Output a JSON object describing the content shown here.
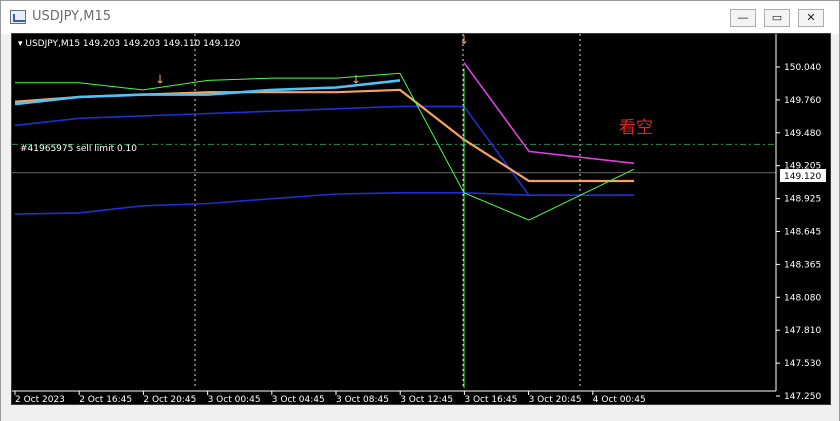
{
  "window": {
    "title": "USDJPY,M15",
    "buttons": {
      "minimize": "—",
      "maximize": "▭",
      "close": "✕"
    }
  },
  "chart": {
    "symbol_header": "▾ USDJPY,M15  149.203 149.203 149.110 149.120",
    "order_label": "#41965975 sell limit 0.10",
    "annotation": "看空",
    "current_price": "149.120",
    "price_axis": [
      "150.040",
      "149.760",
      "149.480",
      "149.205",
      "148.925",
      "148.645",
      "148.365",
      "148.080",
      "147.810",
      "147.530",
      "147.250"
    ],
    "time_axis": [
      "2 Oct 2023",
      "2 Oct 16:45",
      "2 Oct 20:45",
      "3 Oct 00:45",
      "3 Oct 04:45",
      "3 Oct 08:45",
      "3 Oct 12:45",
      "3 Oct 16:45",
      "3 Oct 20:45",
      "4 Oct 00:45"
    ]
  },
  "chart_data": {
    "type": "line",
    "title": "USDJPY,M15",
    "ohlc_last": {
      "open": 149.203,
      "high": 149.203,
      "low": 149.11,
      "close": 149.12
    },
    "order": {
      "id": "#41965975",
      "type": "sell limit",
      "volume": 0.1,
      "price": 149.36
    },
    "ylim": [
      147.25,
      150.25
    ],
    "x": [
      "2 Oct 2023",
      "2 Oct 16:45",
      "2 Oct 20:45",
      "3 Oct 00:45",
      "3 Oct 04:45",
      "3 Oct 08:45",
      "3 Oct 12:45",
      "3 Oct 16:45",
      "3 Oct 20:45",
      "4 Oct 00:45"
    ],
    "series": [
      {
        "values": [
          149.88,
          149.88,
          149.82,
          149.9,
          149.92,
          149.92,
          149.96,
          148.95,
          148.72,
          149.15
        ]
      },
      {
        "color": "#4fc3f7",
        "values": [
          149.7,
          149.76,
          149.78,
          149.78,
          149.82,
          149.84,
          149.9,
          null,
          null,
          null
        ]
      },
      {
        "color": "#f4a460",
        "values": [
          149.72,
          149.76,
          149.78,
          149.8,
          149.8,
          149.8,
          149.82,
          149.4,
          149.05,
          149.05
        ]
      },
      {
        "color": "#e040e0",
        "values": [
          null,
          null,
          null,
          null,
          null,
          null,
          null,
          150.05,
          149.3,
          149.2
        ]
      },
      {
        "color": "#1f2fd0",
        "values": [
          149.52,
          149.58,
          149.6,
          149.62,
          149.64,
          149.66,
          149.68,
          149.68,
          148.93,
          148.93
        ]
      },
      {
        "color": "#1f2fd0",
        "values": [
          148.77,
          148.78,
          148.84,
          148.86,
          148.9,
          148.94,
          148.95,
          148.95,
          148.93,
          148.93
        ]
      }
    ]
  }
}
